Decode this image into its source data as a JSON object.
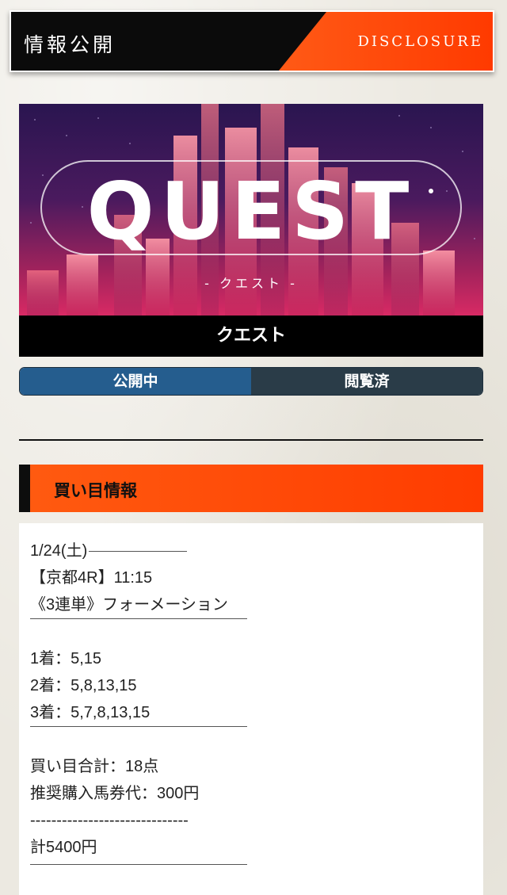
{
  "header": {
    "title": "情報公開",
    "subtitle": "DISCLOSURE"
  },
  "banner": {
    "logo_text": "QUEST",
    "logo_sub": "- クエスト -",
    "caption": "クエスト"
  },
  "tabs": [
    {
      "label": "公開中",
      "active": true
    },
    {
      "label": "閲覧済",
      "active": false
    }
  ],
  "section": {
    "title": "買い目情報"
  },
  "info": {
    "date": "1/24(土)",
    "race": "【京都4R】11:15",
    "bet_type": "《3連単》フォーメーション",
    "first": "1着：5,15",
    "second": "2着：5,8,13,15",
    "third": "3着：5,7,8,13,15",
    "total_points": "買い目合計：18点",
    "recommended": "推奨購入馬券代：300円",
    "dashes": "------------------------------",
    "sum": "計5400円"
  },
  "colors": {
    "accent": "#ff4a00",
    "tab_active": "#255d8e",
    "tab_inactive": "#2a3c48"
  }
}
